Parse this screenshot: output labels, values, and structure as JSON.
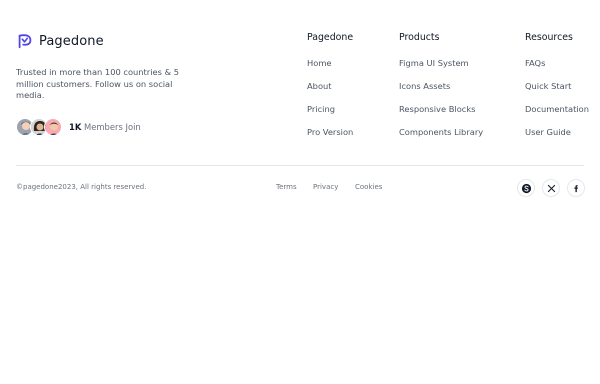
{
  "brand": {
    "name": "Pagedone",
    "logo_icon": "pagedone-logo-icon",
    "accent": "#4f46e5"
  },
  "tagline": "Trusted in more than 100 countries & 5 million customers. Follow us on social media.",
  "members": {
    "count": "1K",
    "label": "Members Join"
  },
  "columns": [
    {
      "title": "Pagedone",
      "links": [
        "Home",
        "About",
        "Pricing",
        "Pro Version"
      ]
    },
    {
      "title": "Products",
      "links": [
        "Figma UI System",
        "Icons Assets",
        "Responsive Blocks",
        "Components Library"
      ]
    },
    {
      "title": "Resources",
      "links": [
        "FAQs",
        "Quick Start",
        "Documentation",
        "User Guide"
      ]
    }
  ],
  "footer": {
    "copyright": "©pagedone2023, All rights reserved.",
    "legal": [
      "Terms",
      "Privacy",
      "Cookies"
    ]
  },
  "social": [
    "skype-icon",
    "x-icon",
    "facebook-icon"
  ]
}
